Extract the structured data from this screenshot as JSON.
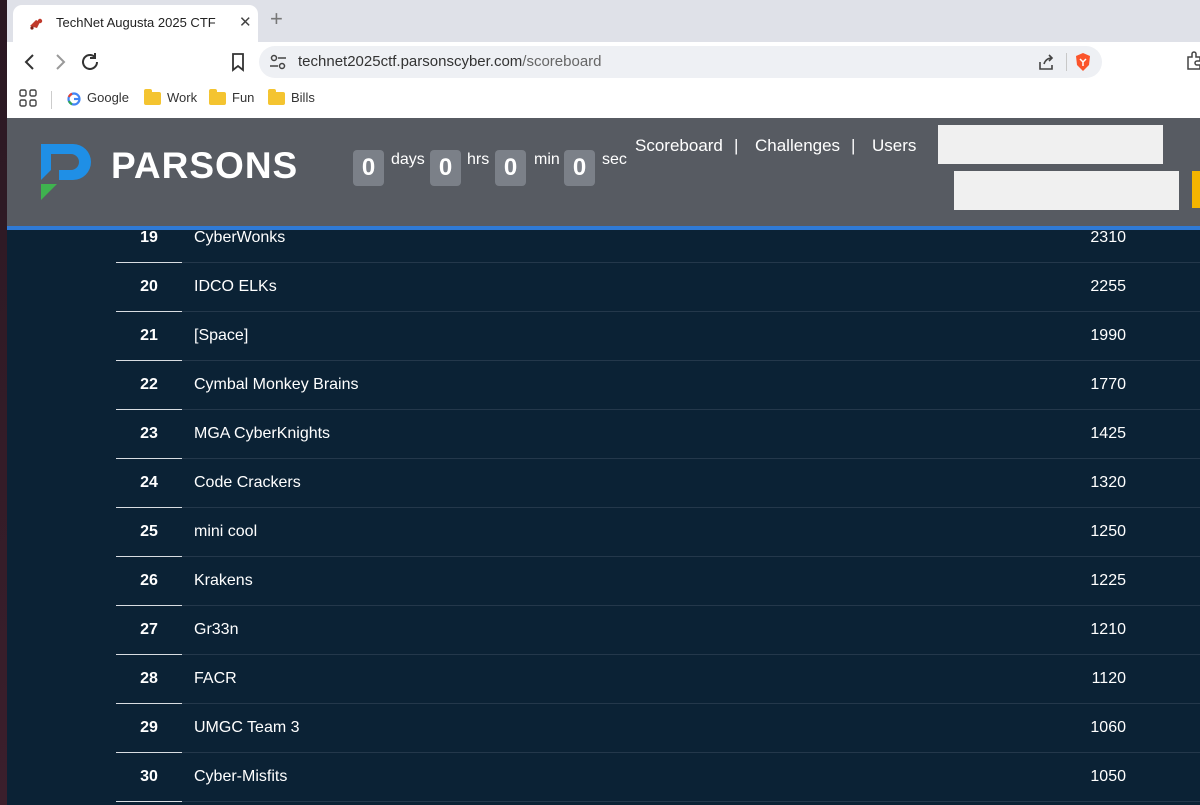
{
  "browser": {
    "tab_title": "TechNet Augusta 2025 CTF",
    "tab_close": "✕",
    "new_tab": "+",
    "url_host": "technet2025ctf.parsonscyber.com",
    "url_path": "/scoreboard",
    "bookmarks": [
      {
        "label": "Google",
        "icon": "google-icon"
      },
      {
        "label": "Work",
        "icon": "folder-icon"
      },
      {
        "label": "Fun",
        "icon": "folder-icon"
      },
      {
        "label": "Bills",
        "icon": "folder-icon"
      }
    ]
  },
  "header": {
    "logo_text": "PARSONS",
    "countdown": {
      "days": "0",
      "days_label": "days",
      "hrs": "0",
      "hrs_label": "hrs",
      "min": "0",
      "min_label": "min",
      "sec": "0",
      "sec_label": "sec"
    },
    "nav": {
      "scoreboard": "Scoreboard",
      "challenges": "Challenges",
      "users": "Users",
      "separator": "|"
    }
  },
  "scoreboard": {
    "rows": [
      {
        "rank": "19",
        "team": "CyberWonks",
        "score": "2310"
      },
      {
        "rank": "20",
        "team": "IDCO ELKs",
        "score": "2255"
      },
      {
        "rank": "21",
        "team": "[Space]",
        "score": "1990"
      },
      {
        "rank": "22",
        "team": "Cymbal Monkey Brains",
        "score": "1770"
      },
      {
        "rank": "23",
        "team": "MGA CyberKnights",
        "score": "1425"
      },
      {
        "rank": "24",
        "team": "Code Crackers",
        "score": "1320"
      },
      {
        "rank": "25",
        "team": "mini cool",
        "score": "1250"
      },
      {
        "rank": "26",
        "team": "Krakens",
        "score": "1225"
      },
      {
        "rank": "27",
        "team": "Gr33n",
        "score": "1210"
      },
      {
        "rank": "28",
        "team": "FACR",
        "score": "1120"
      },
      {
        "rank": "29",
        "team": "UMGC Team 3",
        "score": "1060"
      },
      {
        "rank": "30",
        "team": "Cyber-Misfits",
        "score": "1050"
      }
    ]
  },
  "colors": {
    "page_bg": "#0b2235",
    "header_bg": "#575b62",
    "accent_line": "#2f7ad6",
    "logo_blue": "#1f8fe6",
    "logo_green": "#3fb34f"
  }
}
